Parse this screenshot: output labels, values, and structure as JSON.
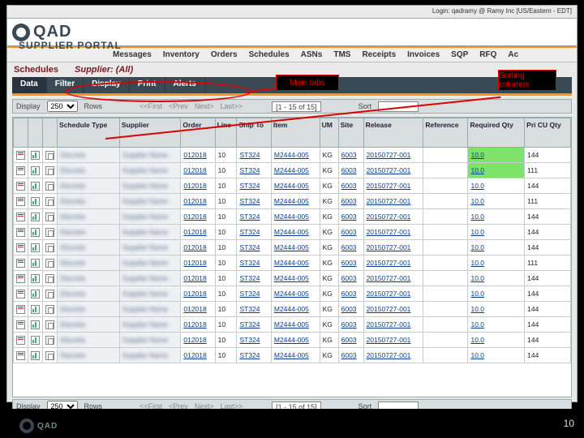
{
  "top_login": "Login: qadramy @ Ramy Inc [US/Eastern - EDT]",
  "brand": "QAD",
  "portal": "SUPPLIER PORTAL",
  "mainnav": [
    "Messages",
    "Inventory",
    "Orders",
    "Schedules",
    "ASNs",
    "TMS",
    "Receipts",
    "Invoices",
    "SQP",
    "RFQ",
    "Ac"
  ],
  "sub_schedules": "Schedules",
  "sub_supplier": "Supplier: (All)",
  "tabs": [
    "Data",
    "Filter",
    "Display",
    "Print",
    "Alerts"
  ],
  "pager": {
    "display_label": "Display",
    "rows_value": "250",
    "rows_label": "Rows",
    "first": "<<First",
    "prev": "<Prev",
    "next": "Next>",
    "last": "Last>>",
    "range": "[1 - 15 of 15]",
    "sort_label": "Sort"
  },
  "columns": [
    "",
    "",
    "",
    "Schedule Type",
    "Supplier",
    "Order",
    "Line",
    "Ship To",
    "Item",
    "UM",
    "Site",
    "Release",
    "Reference",
    "Required Qty",
    "Pri CU Qty"
  ],
  "rows": [
    {
      "order": "012018",
      "line": "10",
      "shipto": "ST324",
      "item": "M2444-005",
      "um": "KG",
      "site": "6003",
      "release": "20150727-001",
      "reqqty": "10.0",
      "pri": "144",
      "green": true
    },
    {
      "order": "012018",
      "line": "10",
      "shipto": "ST324",
      "item": "M2444-005",
      "um": "KG",
      "site": "6003",
      "release": "20150727-001",
      "reqqty": "10.0",
      "pri": "111",
      "green": true
    },
    {
      "order": "012018",
      "line": "10",
      "shipto": "ST324",
      "item": "M2444-005",
      "um": "KG",
      "site": "6003",
      "release": "20150727-001",
      "reqqty": "10.0",
      "pri": "144"
    },
    {
      "order": "012018",
      "line": "10",
      "shipto": "ST324",
      "item": "M2444-005",
      "um": "KG",
      "site": "6003",
      "release": "20150727-001",
      "reqqty": "10.0",
      "pri": "111"
    },
    {
      "order": "012018",
      "line": "10",
      "shipto": "ST324",
      "item": "M2444-005",
      "um": "KG",
      "site": "6003",
      "release": "20150727-001",
      "reqqty": "10.0",
      "pri": "144"
    },
    {
      "order": "012018",
      "line": "10",
      "shipto": "ST324",
      "item": "M2444-005",
      "um": "KG",
      "site": "6003",
      "release": "20150727-001",
      "reqqty": "10.0",
      "pri": "144"
    },
    {
      "order": "012018",
      "line": "10",
      "shipto": "ST324",
      "item": "M2444-005",
      "um": "KG",
      "site": "6003",
      "release": "20150727-001",
      "reqqty": "10.0",
      "pri": "144"
    },
    {
      "order": "012018",
      "line": "10",
      "shipto": "ST324",
      "item": "M2444-005",
      "um": "KG",
      "site": "6003",
      "release": "20150727-001",
      "reqqty": "10.0",
      "pri": "111"
    },
    {
      "order": "012018",
      "line": "10",
      "shipto": "ST324",
      "item": "M2444-005",
      "um": "KG",
      "site": "6003",
      "release": "20150727-001",
      "reqqty": "10.0",
      "pri": "144"
    },
    {
      "order": "012018",
      "line": "10",
      "shipto": "ST324",
      "item": "M2444-005",
      "um": "KG",
      "site": "6003",
      "release": "20150727-001",
      "reqqty": "10.0",
      "pri": "144"
    },
    {
      "order": "012018",
      "line": "10",
      "shipto": "ST324",
      "item": "M2444-005",
      "um": "KG",
      "site": "6003",
      "release": "20150727-001",
      "reqqty": "10.0",
      "pri": "144"
    },
    {
      "order": "012018",
      "line": "10",
      "shipto": "ST324",
      "item": "M2444-005",
      "um": "KG",
      "site": "6003",
      "release": "20150727-001",
      "reqqty": "10.0",
      "pri": "144"
    },
    {
      "order": "012018",
      "line": "10",
      "shipto": "ST324",
      "item": "M2444-005",
      "um": "KG",
      "site": "6003",
      "release": "20150727-001",
      "reqqty": "10.0",
      "pri": "144"
    },
    {
      "order": "012018",
      "line": "10",
      "shipto": "ST324",
      "item": "M2444-005",
      "um": "KG",
      "site": "6003",
      "release": "20150727-001",
      "reqqty": "10.0",
      "pri": "144"
    }
  ],
  "annot_main_tabs": "Main tabs",
  "annot_sort": "Sorting columns",
  "slide_num": "10"
}
